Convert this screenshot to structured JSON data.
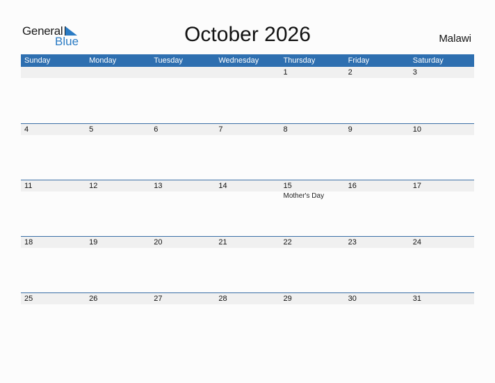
{
  "logo": {
    "word1": "General",
    "word2": "Blue",
    "icon": "triangle-flag-icon"
  },
  "title": "October 2026",
  "country": "Malawi",
  "colors": {
    "header_bg": "#2e6fb0",
    "brand_blue": "#2a7bc4",
    "day_strip": "#f0f0f0"
  },
  "weekdays": [
    "Sunday",
    "Monday",
    "Tuesday",
    "Wednesday",
    "Thursday",
    "Friday",
    "Saturday"
  ],
  "weeks": [
    {
      "days": [
        "",
        "",
        "",
        "",
        "1",
        "2",
        "3"
      ],
      "events": [
        "",
        "",
        "",
        "",
        "",
        "",
        ""
      ]
    },
    {
      "days": [
        "4",
        "5",
        "6",
        "7",
        "8",
        "9",
        "10"
      ],
      "events": [
        "",
        "",
        "",
        "",
        "",
        "",
        ""
      ]
    },
    {
      "days": [
        "11",
        "12",
        "13",
        "14",
        "15",
        "16",
        "17"
      ],
      "events": [
        "",
        "",
        "",
        "",
        "Mother's Day",
        "",
        ""
      ]
    },
    {
      "days": [
        "18",
        "19",
        "20",
        "21",
        "22",
        "23",
        "24"
      ],
      "events": [
        "",
        "",
        "",
        "",
        "",
        "",
        ""
      ]
    },
    {
      "days": [
        "25",
        "26",
        "27",
        "28",
        "29",
        "30",
        "31"
      ],
      "events": [
        "",
        "",
        "",
        "",
        "",
        "",
        ""
      ]
    }
  ]
}
